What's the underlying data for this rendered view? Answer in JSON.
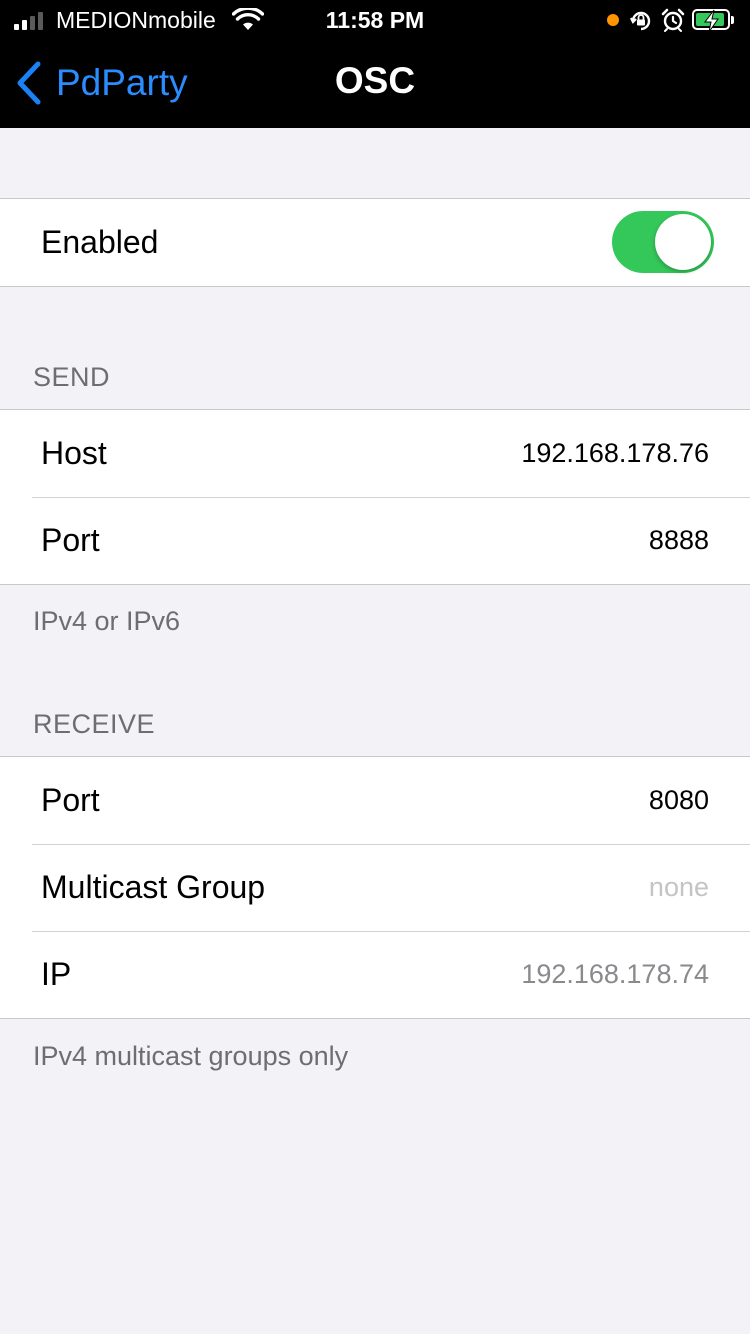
{
  "status_bar": {
    "carrier": "MEDIONmobile",
    "time": "11:58 PM",
    "signal_bars_active": 2,
    "signal_bars_total": 4,
    "icons": [
      "wifi-icon",
      "orientation-lock-icon",
      "alarm-icon",
      "battery-charging-icon"
    ],
    "accent_dot_color": "#ff9500",
    "battery_color": "#34c759"
  },
  "nav": {
    "back_label": "PdParty",
    "title": "OSC"
  },
  "general": {
    "enabled_label": "Enabled",
    "enabled": true
  },
  "send": {
    "header": "SEND",
    "host_label": "Host",
    "host_value": "192.168.178.76",
    "port_label": "Port",
    "port_value": "8888",
    "footer": "IPv4 or IPv6"
  },
  "receive": {
    "header": "RECEIVE",
    "port_label": "Port",
    "port_value": "8080",
    "multicast_label": "Multicast Group",
    "multicast_placeholder": "none",
    "ip_label": "IP",
    "ip_value": "192.168.178.74",
    "footer": "IPv4 multicast groups only"
  },
  "colors": {
    "accent": "#2b8cff",
    "toggle_on": "#34c759",
    "background": "#f2f2f7"
  }
}
